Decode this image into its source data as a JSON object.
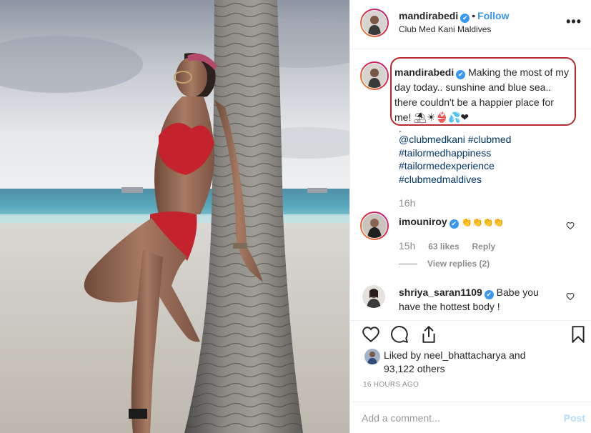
{
  "header": {
    "username": "mandirabedi",
    "verified_mark": "✔",
    "separator": "•",
    "follow_label": "Follow",
    "location": "Club Med Kani Maldives",
    "more_label": "•••"
  },
  "caption": {
    "username": "mandirabedi",
    "text": "Making the most of my day today.. sunshine and blue sea.. there couldn't be a happier place for me! ⛱☀👙💦❤",
    "dot": ".",
    "hashtags": [
      "@clubmedkani #clubmed",
      "#tailormedhappiness",
      "#tailormedexperience",
      "#clubmedmaldives"
    ],
    "time": "16h"
  },
  "comments": [
    {
      "username": "imouniroy",
      "text": "👏👏👏👏",
      "time": "15h",
      "likes": "63 likes",
      "reply": "Reply",
      "view_replies": "View replies (2)"
    },
    {
      "username": "shriya_saran1109",
      "text": "Babe you have the hottest body !"
    }
  ],
  "actions": {
    "like_icon": "heart-icon",
    "comment_icon": "comment-icon",
    "share_icon": "share-icon",
    "save_icon": "bookmark-icon"
  },
  "likes": {
    "line1": "Liked by neel_bhattacharya and",
    "line2": "93,122 others"
  },
  "posted": "16 HOURS AGO",
  "add_comment": {
    "placeholder": "Add a comment...",
    "post_label": "Post"
  },
  "colors": {
    "link": "#3897f0",
    "hashtag": "#003569",
    "muted": "#8e8e8e",
    "highlight_box": "#b52a2f"
  }
}
